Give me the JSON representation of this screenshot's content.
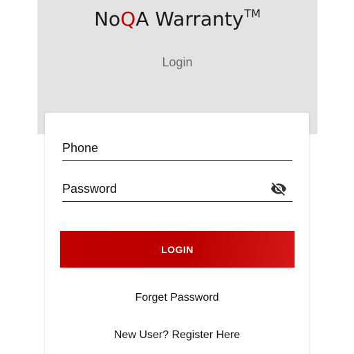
{
  "brand": {
    "prefix": "No",
    "accent_letter": "Q",
    "suffix": "A Warranty",
    "trademark": "TM",
    "accent_color": "#c40000"
  },
  "header": {
    "subtitle": "Login",
    "background": "#e3e3e3"
  },
  "form": {
    "phone_placeholder": "Phone",
    "password_placeholder": "Password",
    "visibility_icon": "eye-off-icon"
  },
  "actions": {
    "login_label": "LOGIN",
    "login_color": "#c00000",
    "forget_password": "Forget Password",
    "register": "New User? Register Here"
  }
}
